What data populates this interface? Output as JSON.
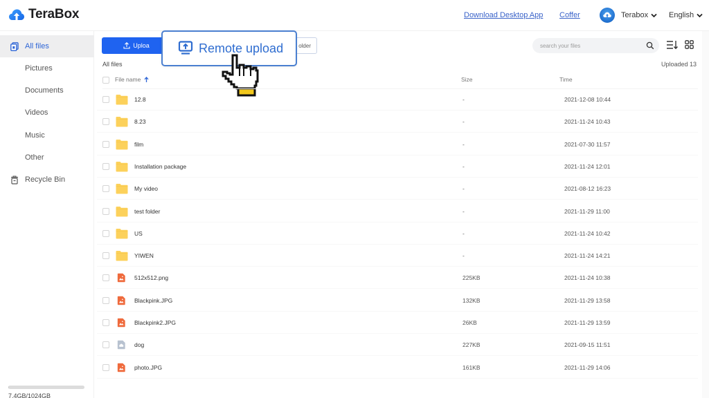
{
  "app": {
    "name": "TeraBox"
  },
  "header": {
    "download_link": "Download Desktop App",
    "coffer_link": "Coffer",
    "user_name": "Terabox",
    "language": "English"
  },
  "sidebar": {
    "items": [
      {
        "label": "All files",
        "icon": "all-files-icon",
        "active": true
      },
      {
        "label": "Pictures"
      },
      {
        "label": "Documents"
      },
      {
        "label": "Videos"
      },
      {
        "label": "Music"
      },
      {
        "label": "Other"
      },
      {
        "label": "Recycle Bin",
        "icon": "trash-icon"
      }
    ],
    "storage": {
      "text": "7.4GB/1024GB",
      "used_fraction": 0.007
    }
  },
  "toolbar": {
    "upload_label": "Upload",
    "upload_visible_label": "Uploa",
    "folder_visible_label": "older",
    "remote_upload_label": "Remote upload",
    "search_placeholder": "search your files"
  },
  "breadcrumb": "All files",
  "uploaded_count_label": "Uploaded 13",
  "table": {
    "columns": {
      "name": "File name",
      "size": "Size",
      "time": "Time"
    },
    "rows": [
      {
        "name": "12.8",
        "type": "folder",
        "size": "-",
        "time": "2021-12-08 10:44"
      },
      {
        "name": "8.23",
        "type": "folder",
        "size": "-",
        "time": "2021-11-24 10:43"
      },
      {
        "name": "film",
        "type": "folder",
        "size": "-",
        "time": "2021-07-30 11:57"
      },
      {
        "name": "Installation package",
        "type": "folder",
        "size": "-",
        "time": "2021-11-24 12:01"
      },
      {
        "name": "My video",
        "type": "folder",
        "size": "-",
        "time": "2021-08-12 16:23"
      },
      {
        "name": "test folder",
        "type": "folder",
        "size": "-",
        "time": "2021-11-29 11:00"
      },
      {
        "name": "US",
        "type": "folder",
        "size": "-",
        "time": "2021-11-24 10:42"
      },
      {
        "name": "YIWEN",
        "type": "folder",
        "size": "-",
        "time": "2021-11-24 14:21"
      },
      {
        "name": "512x512.png",
        "type": "image",
        "size": "225KB",
        "time": "2021-11-24 10:38"
      },
      {
        "name": "Blackpink.JPG",
        "type": "image",
        "size": "132KB",
        "time": "2021-11-29 13:58"
      },
      {
        "name": "Blackpink2.JPG",
        "type": "image",
        "size": "26KB",
        "time": "2021-11-29 13:59"
      },
      {
        "name": "dog",
        "type": "unknown",
        "size": "227KB",
        "time": "2021-09-15 11:51"
      },
      {
        "name": "photo.JPG",
        "type": "image",
        "size": "161KB",
        "time": "2021-11-29 14:06"
      }
    ]
  },
  "colors": {
    "brand_blue": "#1f63f0",
    "active_text": "#2f66d6",
    "folder_yellow": "#fcd15b",
    "image_orange": "#ef6a3c",
    "unknown_gray": "#b8c2d0",
    "cursor_cuff": "#f2c81d"
  }
}
